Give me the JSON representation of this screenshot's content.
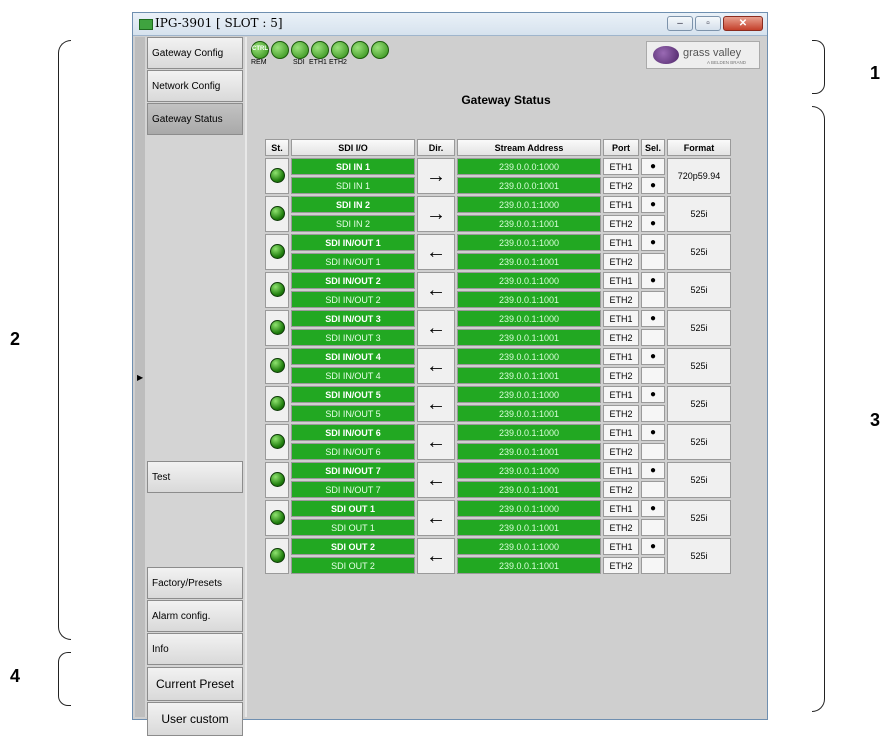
{
  "callouts": [
    "1",
    "2",
    "3",
    "4"
  ],
  "window": {
    "title": "IPG-3901   [ SLOT : 5]",
    "controls": {
      "minimize": "–",
      "maximize": "▫",
      "close": "✕"
    }
  },
  "nav": {
    "items": [
      {
        "label": "Gateway Config"
      },
      {
        "label": "Network Config"
      },
      {
        "label": "Gateway Status"
      },
      {
        "label": "Test"
      },
      {
        "label": "Factory/Presets"
      },
      {
        "label": "Alarm config."
      },
      {
        "label": "Info"
      }
    ],
    "presets": [
      {
        "label": "Current Preset"
      },
      {
        "label": "User custom"
      }
    ]
  },
  "toolbar": {
    "ctrl": "CTRL",
    "labels": [
      "REM",
      "SDI",
      "ETH1",
      "ETH2"
    ]
  },
  "logo": {
    "text": "grass valley",
    "sub": "A BELDEN BRAND"
  },
  "page_title": "Gateway Status",
  "table": {
    "headers": [
      "St.",
      "SDI I/O",
      "Dir.",
      "Stream Address",
      "Port",
      "Sel.",
      "Format"
    ],
    "rows": [
      {
        "name": "SDI IN 1",
        "sub": "SDI IN 1",
        "dir": "→",
        "addr1": "239.0.0.0:1000",
        "addr2": "239.0.0.0:1001",
        "port1": "ETH1",
        "port2": "ETH2",
        "sel1": "●",
        "sel2": "●",
        "format": "720p59.94"
      },
      {
        "name": "SDI IN 2",
        "sub": "SDI IN 2",
        "dir": "→",
        "addr1": "239.0.0.1:1000",
        "addr2": "239.0.0.1:1001",
        "port1": "ETH1",
        "port2": "ETH2",
        "sel1": "●",
        "sel2": "●",
        "format": "525i"
      },
      {
        "name": "SDI IN/OUT 1",
        "sub": "SDI IN/OUT 1",
        "dir": "←",
        "addr1": "239.0.0.1:1000",
        "addr2": "239.0.0.1:1001",
        "port1": "ETH1",
        "port2": "ETH2",
        "sel1": "●",
        "sel2": "",
        "format": "525i"
      },
      {
        "name": "SDI IN/OUT 2",
        "sub": "SDI IN/OUT 2",
        "dir": "←",
        "addr1": "239.0.0.1:1000",
        "addr2": "239.0.0.1:1001",
        "port1": "ETH1",
        "port2": "ETH2",
        "sel1": "●",
        "sel2": "",
        "format": "525i"
      },
      {
        "name": "SDI IN/OUT 3",
        "sub": "SDI IN/OUT 3",
        "dir": "←",
        "addr1": "239.0.0.1:1000",
        "addr2": "239.0.0.1:1001",
        "port1": "ETH1",
        "port2": "ETH2",
        "sel1": "●",
        "sel2": "",
        "format": "525i"
      },
      {
        "name": "SDI IN/OUT 4",
        "sub": "SDI IN/OUT 4",
        "dir": "←",
        "addr1": "239.0.0.1:1000",
        "addr2": "239.0.0.1:1001",
        "port1": "ETH1",
        "port2": "ETH2",
        "sel1": "●",
        "sel2": "",
        "format": "525i"
      },
      {
        "name": "SDI IN/OUT 5",
        "sub": "SDI IN/OUT 5",
        "dir": "←",
        "addr1": "239.0.0.1:1000",
        "addr2": "239.0.0.1:1001",
        "port1": "ETH1",
        "port2": "ETH2",
        "sel1": "●",
        "sel2": "",
        "format": "525i"
      },
      {
        "name": "SDI IN/OUT 6",
        "sub": "SDI IN/OUT 6",
        "dir": "←",
        "addr1": "239.0.0.1:1000",
        "addr2": "239.0.0.1:1001",
        "port1": "ETH1",
        "port2": "ETH2",
        "sel1": "●",
        "sel2": "",
        "format": "525i"
      },
      {
        "name": "SDI IN/OUT 7",
        "sub": "SDI IN/OUT 7",
        "dir": "←",
        "addr1": "239.0.0.1:1000",
        "addr2": "239.0.0.1:1001",
        "port1": "ETH1",
        "port2": "ETH2",
        "sel1": "●",
        "sel2": "",
        "format": "525i"
      },
      {
        "name": "SDI OUT 1",
        "sub": "SDI OUT 1",
        "dir": "←",
        "addr1": "239.0.0.1:1000",
        "addr2": "239.0.0.1:1001",
        "port1": "ETH1",
        "port2": "ETH2",
        "sel1": "●",
        "sel2": "",
        "format": "525i"
      },
      {
        "name": "SDI OUT 2",
        "sub": "SDI OUT 2",
        "dir": "←",
        "addr1": "239.0.0.1:1000",
        "addr2": "239.0.0.1:1001",
        "port1": "ETH1",
        "port2": "ETH2",
        "sel1": "●",
        "sel2": "",
        "format": "525i"
      }
    ]
  }
}
